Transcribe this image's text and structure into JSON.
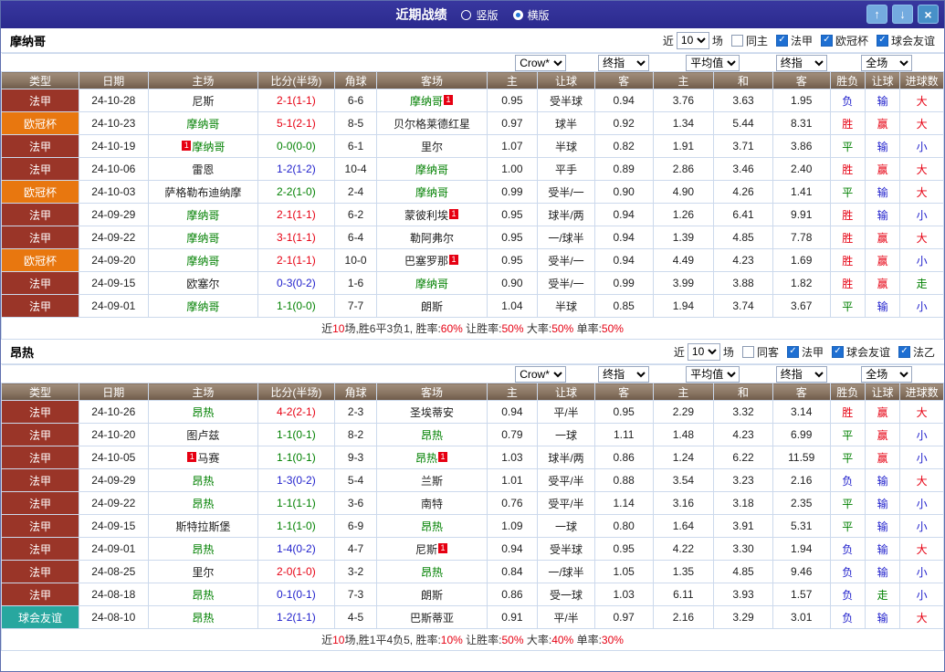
{
  "window": {
    "title": "近期战绩",
    "layout_options": [
      {
        "label": "竖版",
        "selected": false
      },
      {
        "label": "横版",
        "selected": true
      }
    ],
    "controls": {
      "up_icon": "↑",
      "down_icon": "↓",
      "close_icon": "×"
    }
  },
  "league_colors": {
    "法甲": "#9a3528",
    "欧冠杯": "#e8770f",
    "球会友谊": "#28a79f"
  },
  "table": {
    "dropdowns": [
      {
        "label": "Crow*",
        "span": 2,
        "name": "bookmaker-select"
      },
      {
        "label": "终指",
        "span": 1,
        "name": "final-handicap-odds-select"
      },
      {
        "label": "平均值",
        "span": 2,
        "name": "average-odds-select"
      },
      {
        "label": "终指",
        "span": 1,
        "name": "final-europe-odds-select"
      },
      {
        "label": "全场",
        "span": 3,
        "name": "fulltime-select"
      }
    ],
    "columns": [
      "类型",
      "日期",
      "主场",
      "比分(半场)",
      "角球",
      "客场",
      "主",
      "让球",
      "客",
      "主",
      "和",
      "客",
      "胜负",
      "让球",
      "进球数"
    ]
  },
  "sections": [
    {
      "team": "摩纳哥",
      "filter": {
        "prefix": "近",
        "count": "10",
        "suffix": "场",
        "same": {
          "label": "同主",
          "checked": false
        },
        "leagues": [
          {
            "label": "法甲",
            "checked": true
          },
          {
            "label": "欧冠杯",
            "checked": true
          },
          {
            "label": "球会友谊",
            "checked": true
          }
        ]
      },
      "rows": [
        {
          "league": "法甲",
          "date": "24-10-28",
          "home": {
            "name": "尼斯"
          },
          "away": {
            "name": "摩纳哥",
            "focal": true,
            "card": "1"
          },
          "score": "2-1(1-1)",
          "score_color": "red",
          "corner": "6-6",
          "asian": [
            "0.95",
            "受半球",
            "0.94"
          ],
          "europe": [
            "3.76",
            "3.63",
            "1.95"
          ],
          "verdicts": [
            [
              "负",
              "blue"
            ],
            [
              "输",
              "blue"
            ],
            [
              "大",
              "red"
            ]
          ]
        },
        {
          "league": "欧冠杯",
          "date": "24-10-23",
          "home": {
            "name": "摩纳哥",
            "focal": true
          },
          "away": {
            "name": "贝尔格莱德红星"
          },
          "score": "5-1(2-1)",
          "score_color": "red",
          "corner": "8-5",
          "asian": [
            "0.97",
            "球半",
            "0.92"
          ],
          "europe": [
            "1.34",
            "5.44",
            "8.31"
          ],
          "verdicts": [
            [
              "胜",
              "red"
            ],
            [
              "赢",
              "red"
            ],
            [
              "大",
              "red"
            ]
          ]
        },
        {
          "league": "法甲",
          "date": "24-10-19",
          "home": {
            "name": "摩纳哥",
            "focal": true,
            "card": "1",
            "card_left": true
          },
          "away": {
            "name": "里尔"
          },
          "score": "0-0(0-0)",
          "score_color": "green",
          "corner": "6-1",
          "asian": [
            "1.07",
            "半球",
            "0.82"
          ],
          "europe": [
            "1.91",
            "3.71",
            "3.86"
          ],
          "verdicts": [
            [
              "平",
              "green"
            ],
            [
              "输",
              "blue"
            ],
            [
              "小",
              "blue"
            ]
          ]
        },
        {
          "league": "法甲",
          "date": "24-10-06",
          "home": {
            "name": "雷恩"
          },
          "away": {
            "name": "摩纳哥",
            "focal": true
          },
          "score": "1-2(1-2)",
          "score_color": "blue",
          "corner": "10-4",
          "asian": [
            "1.00",
            "平手",
            "0.89"
          ],
          "europe": [
            "2.86",
            "3.46",
            "2.40"
          ],
          "verdicts": [
            [
              "胜",
              "red"
            ],
            [
              "赢",
              "red"
            ],
            [
              "大",
              "red"
            ]
          ]
        },
        {
          "league": "欧冠杯",
          "date": "24-10-03",
          "home": {
            "name": "萨格勒布迪纳摩"
          },
          "away": {
            "name": "摩纳哥",
            "focal": true
          },
          "score": "2-2(1-0)",
          "score_color": "green",
          "corner": "2-4",
          "asian": [
            "0.99",
            "受半/一",
            "0.90"
          ],
          "europe": [
            "4.90",
            "4.26",
            "1.41"
          ],
          "verdicts": [
            [
              "平",
              "green"
            ],
            [
              "输",
              "blue"
            ],
            [
              "大",
              "red"
            ]
          ]
        },
        {
          "league": "法甲",
          "date": "24-09-29",
          "home": {
            "name": "摩纳哥",
            "focal": true
          },
          "away": {
            "name": "蒙彼利埃",
            "card": "1"
          },
          "score": "2-1(1-1)",
          "score_color": "red",
          "corner": "6-2",
          "asian": [
            "0.95",
            "球半/两",
            "0.94"
          ],
          "europe": [
            "1.26",
            "6.41",
            "9.91"
          ],
          "verdicts": [
            [
              "胜",
              "red"
            ],
            [
              "输",
              "blue"
            ],
            [
              "小",
              "blue"
            ]
          ]
        },
        {
          "league": "法甲",
          "date": "24-09-22",
          "home": {
            "name": "摩纳哥",
            "focal": true
          },
          "away": {
            "name": "勒阿弗尔"
          },
          "score": "3-1(1-1)",
          "score_color": "red",
          "corner": "6-4",
          "asian": [
            "0.95",
            "一/球半",
            "0.94"
          ],
          "europe": [
            "1.39",
            "4.85",
            "7.78"
          ],
          "verdicts": [
            [
              "胜",
              "red"
            ],
            [
              "赢",
              "red"
            ],
            [
              "大",
              "red"
            ]
          ]
        },
        {
          "league": "欧冠杯",
          "date": "24-09-20",
          "home": {
            "name": "摩纳哥",
            "focal": true
          },
          "away": {
            "name": "巴塞罗那",
            "card": "1"
          },
          "score": "2-1(1-1)",
          "score_color": "red",
          "corner": "10-0",
          "asian": [
            "0.95",
            "受半/一",
            "0.94"
          ],
          "europe": [
            "4.49",
            "4.23",
            "1.69"
          ],
          "verdicts": [
            [
              "胜",
              "red"
            ],
            [
              "赢",
              "red"
            ],
            [
              "小",
              "blue"
            ]
          ]
        },
        {
          "league": "法甲",
          "date": "24-09-15",
          "home": {
            "name": "欧塞尔"
          },
          "away": {
            "name": "摩纳哥",
            "focal": true
          },
          "score": "0-3(0-2)",
          "score_color": "blue",
          "corner": "1-6",
          "asian": [
            "0.90",
            "受半/一",
            "0.99"
          ],
          "europe": [
            "3.99",
            "3.88",
            "1.82"
          ],
          "verdicts": [
            [
              "胜",
              "red"
            ],
            [
              "赢",
              "red"
            ],
            [
              "走",
              "green"
            ]
          ]
        },
        {
          "league": "法甲",
          "date": "24-09-01",
          "home": {
            "name": "摩纳哥",
            "focal": true
          },
          "away": {
            "name": "朗斯"
          },
          "score": "1-1(0-0)",
          "score_color": "green",
          "corner": "7-7",
          "asian": [
            "1.04",
            "半球",
            "0.85"
          ],
          "europe": [
            "1.94",
            "3.74",
            "3.67"
          ],
          "verdicts": [
            [
              "平",
              "green"
            ],
            [
              "输",
              "blue"
            ],
            [
              "小",
              "blue"
            ]
          ]
        }
      ],
      "summary": [
        {
          "t": "近"
        },
        {
          "t": "10",
          "red": true
        },
        {
          "t": "场,胜6平3负1, 胜率:"
        },
        {
          "t": "60%",
          "red": true
        },
        {
          "t": " 让胜率:"
        },
        {
          "t": "50%",
          "red": true
        },
        {
          "t": " 大率:"
        },
        {
          "t": "50%",
          "red": true
        },
        {
          "t": " 单率:"
        },
        {
          "t": "50%",
          "red": true
        }
      ]
    },
    {
      "team": "昂热",
      "filter": {
        "prefix": "近",
        "count": "10",
        "suffix": "场",
        "same": {
          "label": "同客",
          "checked": false
        },
        "leagues": [
          {
            "label": "法甲",
            "checked": true
          },
          {
            "label": "球会友谊",
            "checked": true
          },
          {
            "label": "法乙",
            "checked": true
          }
        ]
      },
      "rows": [
        {
          "league": "法甲",
          "date": "24-10-26",
          "home": {
            "name": "昂热",
            "focal": true
          },
          "away": {
            "name": "圣埃蒂安"
          },
          "score": "4-2(2-1)",
          "score_color": "red",
          "corner": "2-3",
          "asian": [
            "0.94",
            "平/半",
            "0.95"
          ],
          "europe": [
            "2.29",
            "3.32",
            "3.14"
          ],
          "verdicts": [
            [
              "胜",
              "red"
            ],
            [
              "赢",
              "red"
            ],
            [
              "大",
              "red"
            ]
          ]
        },
        {
          "league": "法甲",
          "date": "24-10-20",
          "home": {
            "name": "图卢兹"
          },
          "away": {
            "name": "昂热",
            "focal": true
          },
          "score": "1-1(0-1)",
          "score_color": "green",
          "corner": "8-2",
          "asian": [
            "0.79",
            "一球",
            "1.11"
          ],
          "europe": [
            "1.48",
            "4.23",
            "6.99"
          ],
          "verdicts": [
            [
              "平",
              "green"
            ],
            [
              "赢",
              "red"
            ],
            [
              "小",
              "blue"
            ]
          ]
        },
        {
          "league": "法甲",
          "date": "24-10-05",
          "home": {
            "name": "马赛",
            "card": "1",
            "card_left": true
          },
          "away": {
            "name": "昂热",
            "focal": true,
            "card": "1"
          },
          "score": "1-1(0-1)",
          "score_color": "green",
          "corner": "9-3",
          "asian": [
            "1.03",
            "球半/两",
            "0.86"
          ],
          "europe": [
            "1.24",
            "6.22",
            "11.59"
          ],
          "verdicts": [
            [
              "平",
              "green"
            ],
            [
              "赢",
              "red"
            ],
            [
              "小",
              "blue"
            ]
          ]
        },
        {
          "league": "法甲",
          "date": "24-09-29",
          "home": {
            "name": "昂热",
            "focal": true
          },
          "away": {
            "name": "兰斯"
          },
          "score": "1-3(0-2)",
          "score_color": "blue",
          "corner": "5-4",
          "asian": [
            "1.01",
            "受平/半",
            "0.88"
          ],
          "europe": [
            "3.54",
            "3.23",
            "2.16"
          ],
          "verdicts": [
            [
              "负",
              "blue"
            ],
            [
              "输",
              "blue"
            ],
            [
              "大",
              "red"
            ]
          ]
        },
        {
          "league": "法甲",
          "date": "24-09-22",
          "home": {
            "name": "昂热",
            "focal": true
          },
          "away": {
            "name": "南特"
          },
          "score": "1-1(1-1)",
          "score_color": "green",
          "corner": "3-6",
          "asian": [
            "0.76",
            "受平/半",
            "1.14"
          ],
          "europe": [
            "3.16",
            "3.18",
            "2.35"
          ],
          "verdicts": [
            [
              "平",
              "green"
            ],
            [
              "输",
              "blue"
            ],
            [
              "小",
              "blue"
            ]
          ]
        },
        {
          "league": "法甲",
          "date": "24-09-15",
          "home": {
            "name": "斯特拉斯堡"
          },
          "away": {
            "name": "昂热",
            "focal": true
          },
          "score": "1-1(1-0)",
          "score_color": "green",
          "corner": "6-9",
          "asian": [
            "1.09",
            "一球",
            "0.80"
          ],
          "europe": [
            "1.64",
            "3.91",
            "5.31"
          ],
          "verdicts": [
            [
              "平",
              "green"
            ],
            [
              "输",
              "blue"
            ],
            [
              "小",
              "blue"
            ]
          ]
        },
        {
          "league": "法甲",
          "date": "24-09-01",
          "home": {
            "name": "昂热",
            "focal": true
          },
          "away": {
            "name": "尼斯",
            "card": "1"
          },
          "score": "1-4(0-2)",
          "score_color": "blue",
          "corner": "4-7",
          "asian": [
            "0.94",
            "受半球",
            "0.95"
          ],
          "europe": [
            "4.22",
            "3.30",
            "1.94"
          ],
          "verdicts": [
            [
              "负",
              "blue"
            ],
            [
              "输",
              "blue"
            ],
            [
              "大",
              "red"
            ]
          ]
        },
        {
          "league": "法甲",
          "date": "24-08-25",
          "home": {
            "name": "里尔"
          },
          "away": {
            "name": "昂热",
            "focal": true
          },
          "score": "2-0(1-0)",
          "score_color": "red",
          "corner": "3-2",
          "asian": [
            "0.84",
            "一/球半",
            "1.05"
          ],
          "europe": [
            "1.35",
            "4.85",
            "9.46"
          ],
          "verdicts": [
            [
              "负",
              "blue"
            ],
            [
              "输",
              "blue"
            ],
            [
              "小",
              "blue"
            ]
          ]
        },
        {
          "league": "法甲",
          "date": "24-08-18",
          "home": {
            "name": "昂热",
            "focal": true
          },
          "away": {
            "name": "朗斯"
          },
          "score": "0-1(0-1)",
          "score_color": "blue",
          "corner": "7-3",
          "asian": [
            "0.86",
            "受一球",
            "1.03"
          ],
          "europe": [
            "6.11",
            "3.93",
            "1.57"
          ],
          "verdicts": [
            [
              "负",
              "blue"
            ],
            [
              "走",
              "green"
            ],
            [
              "小",
              "blue"
            ]
          ]
        },
        {
          "league": "球会友谊",
          "date": "24-08-10",
          "home": {
            "name": "昂热",
            "focal": true
          },
          "away": {
            "name": "巴斯蒂亚"
          },
          "score": "1-2(1-1)",
          "score_color": "blue",
          "corner": "4-5",
          "asian": [
            "0.91",
            "平/半",
            "0.97"
          ],
          "europe": [
            "2.16",
            "3.29",
            "3.01"
          ],
          "verdicts": [
            [
              "负",
              "blue"
            ],
            [
              "输",
              "blue"
            ],
            [
              "大",
              "red"
            ]
          ]
        }
      ],
      "summary": [
        {
          "t": "近"
        },
        {
          "t": "10",
          "red": true
        },
        {
          "t": "场,胜1平4负5, 胜率:"
        },
        {
          "t": "10%",
          "red": true
        },
        {
          "t": " 让胜率:"
        },
        {
          "t": "50%",
          "red": true
        },
        {
          "t": " 大率:"
        },
        {
          "t": "40%",
          "red": true
        },
        {
          "t": " 单率:"
        },
        {
          "t": "30%",
          "red": true
        }
      ]
    }
  ]
}
